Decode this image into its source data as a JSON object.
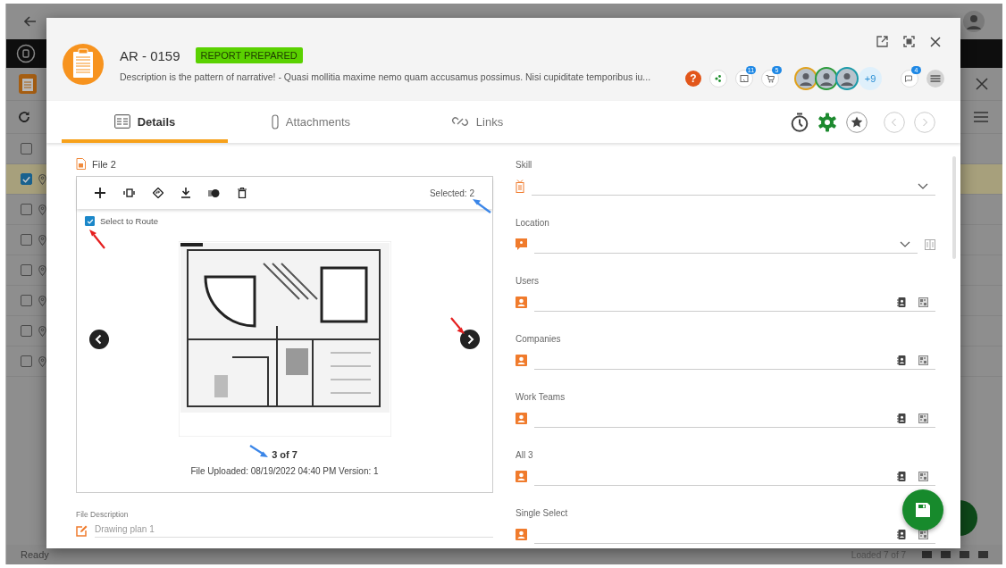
{
  "background": {
    "select_all": {
      "checked": false
    },
    "rows": [
      {
        "checked": true
      },
      {
        "checked": false
      },
      {
        "checked": false
      },
      {
        "checked": false
      },
      {
        "checked": false
      },
      {
        "checked": false
      },
      {
        "checked": false
      }
    ],
    "status": "Ready",
    "loaded": "Loaded 7 of 7"
  },
  "header": {
    "code": "AR - 0159",
    "status": "REPORT PREPARED",
    "description": "Description is the pattern of narrative!  - Quasi mollitia maxime nemo quam accusamus possimus. Nisi cupiditate temporibus iu...",
    "help": "?",
    "tasks_badge": "11",
    "cart_badge": "5",
    "avatars": [
      {
        "color": "#e0a11b"
      },
      {
        "color": "#2a9b3a"
      },
      {
        "color": "#1a9aa8"
      }
    ],
    "more_people": "+9",
    "chat_badge": "4"
  },
  "tabs": [
    {
      "label": "Details",
      "selected": true
    },
    {
      "label": "Attachments",
      "selected": false
    },
    {
      "label": "Links",
      "selected": false
    }
  ],
  "file": {
    "title": "File 2",
    "selected_count": "Selected: 2",
    "select_to_route": {
      "label": "Select to Route",
      "checked": true
    },
    "pager": "3 of 7",
    "uploaded": "File Uploaded: 08/19/2022  04:40 PM  Version: 1"
  },
  "file_description": {
    "label": "File Description",
    "value": "Drawing plan 1"
  },
  "fields": [
    {
      "label": "Skill",
      "kind": "skill"
    },
    {
      "label": "Location",
      "kind": "location"
    },
    {
      "label": "Users",
      "kind": "picker"
    },
    {
      "label": "Companies",
      "kind": "picker"
    },
    {
      "label": "Work Teams",
      "kind": "picker"
    },
    {
      "label": "All 3",
      "kind": "picker"
    },
    {
      "label": "Single Select",
      "kind": "picker"
    }
  ]
}
